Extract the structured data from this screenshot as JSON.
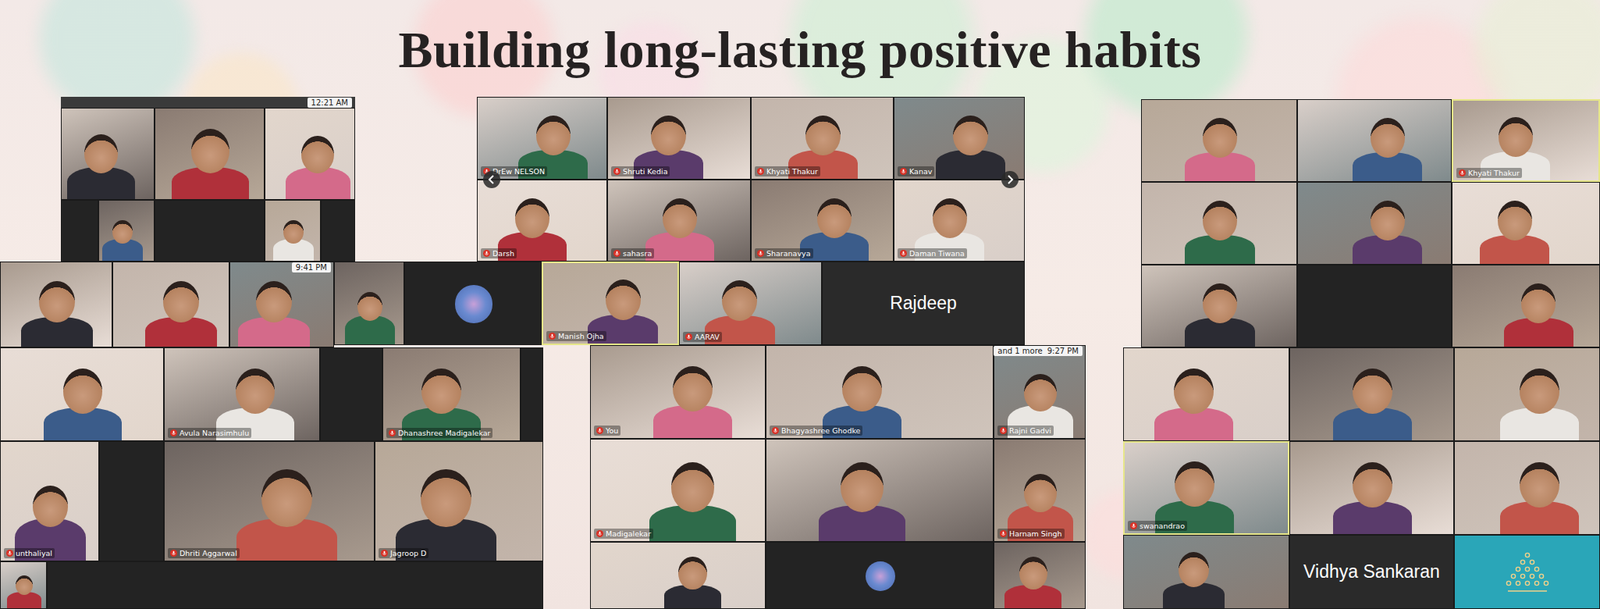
{
  "title": "Building long-lasting positive habits",
  "panels": [
    {
      "clock": "12:21 AM",
      "tiles": [
        {
          "kind": "video",
          "speaking": false
        },
        {
          "kind": "video",
          "speaking": false
        },
        {
          "kind": "video",
          "speaking": false
        },
        {
          "kind": "blank",
          "speaking": false
        },
        {
          "kind": "video",
          "speaking": false
        },
        {
          "kind": "blank",
          "speaking": false
        },
        {
          "kind": "video",
          "speaking": false
        },
        {
          "kind": "blank",
          "speaking": false
        }
      ]
    },
    {
      "tiles": [
        {
          "kind": "video",
          "label": "DrEw NELSON",
          "speaking": false
        },
        {
          "kind": "video",
          "label": "Shruti Kedia",
          "speaking": false
        },
        {
          "kind": "video",
          "label": "Khyati Thakur",
          "speaking": false
        },
        {
          "kind": "video",
          "label": "Kanav",
          "speaking": false
        },
        {
          "kind": "video",
          "label": "Darsh",
          "speaking": false
        },
        {
          "kind": "video",
          "label": "sahasra",
          "speaking": false
        },
        {
          "kind": "video",
          "label": "Sharanavya",
          "speaking": false
        },
        {
          "kind": "video",
          "label": "Daman Tiwana",
          "speaking": false
        }
      ]
    },
    {
      "tiles": [
        {
          "kind": "video",
          "speaking": false
        },
        {
          "kind": "avatar",
          "speaking": false
        },
        {
          "kind": "video",
          "label": "Manish Ojha",
          "speaking": true
        },
        {
          "kind": "video",
          "label": "AARAV",
          "speaking": false
        },
        {
          "kind": "name",
          "label": "Rajdeep",
          "speaking": false
        }
      ]
    },
    {
      "clock": "9:41 PM",
      "tiles": [
        {
          "kind": "video",
          "speaking": false
        },
        {
          "kind": "video",
          "speaking": false
        },
        {
          "kind": "video",
          "speaking": false
        }
      ]
    },
    {
      "tiles": [
        {
          "kind": "video",
          "speaking": false
        },
        {
          "kind": "video",
          "label": "Avula Narasimhulu",
          "speaking": false
        },
        {
          "kind": "blank",
          "speaking": false
        },
        {
          "kind": "video",
          "label": "Dhanashree Madigalekar",
          "speaking": false
        },
        {
          "kind": "blank",
          "speaking": false
        },
        {
          "kind": "video",
          "label": "unthaliyal",
          "speaking": false
        },
        {
          "kind": "blank",
          "speaking": false
        },
        {
          "kind": "video",
          "label": "Dhriti Aggarwal",
          "speaking": false
        },
        {
          "kind": "video",
          "label": "Jagroop D",
          "speaking": false
        },
        {
          "kind": "video",
          "speaking": false
        },
        {
          "kind": "blank",
          "speaking": false
        }
      ]
    },
    {
      "clock": "9:27 PM",
      "extra": "and 1 more",
      "tiles": [
        {
          "kind": "video",
          "label": "You",
          "speaking": false
        },
        {
          "kind": "video",
          "label": "Bhagyashree Ghodke",
          "speaking": false
        },
        {
          "kind": "video",
          "label": "Rajni Gadvi",
          "speaking": false
        },
        {
          "kind": "video",
          "label": "Madigalekar",
          "speaking": false
        },
        {
          "kind": "video",
          "speaking": false
        },
        {
          "kind": "video",
          "label": "Harnam Singh",
          "speaking": false
        },
        {
          "kind": "video",
          "speaking": false
        },
        {
          "kind": "avatar",
          "speaking": false
        },
        {
          "kind": "video",
          "speaking": false
        }
      ]
    },
    {
      "tiles": [
        {
          "kind": "video",
          "speaking": false
        },
        {
          "kind": "video",
          "speaking": false
        },
        {
          "kind": "video",
          "label": "Khyati Thakur",
          "speaking": true
        },
        {
          "kind": "video",
          "speaking": false
        },
        {
          "kind": "video",
          "speaking": false
        },
        {
          "kind": "video",
          "speaking": false
        },
        {
          "kind": "video",
          "speaking": false
        },
        {
          "kind": "blank",
          "speaking": false
        },
        {
          "kind": "video",
          "speaking": false
        }
      ]
    },
    {
      "tiles": [
        {
          "kind": "video",
          "speaking": false
        },
        {
          "kind": "video",
          "speaking": false
        },
        {
          "kind": "video",
          "speaking": false
        },
        {
          "kind": "video",
          "label": "swanandrao",
          "speaking": true
        },
        {
          "kind": "video",
          "speaking": false
        },
        {
          "kind": "video",
          "speaking": false
        },
        {
          "kind": "video",
          "speaking": false
        },
        {
          "kind": "name",
          "label": "Vidhya Sankaran",
          "speaking": false
        },
        {
          "kind": "logo",
          "speaking": false
        }
      ]
    }
  ]
}
